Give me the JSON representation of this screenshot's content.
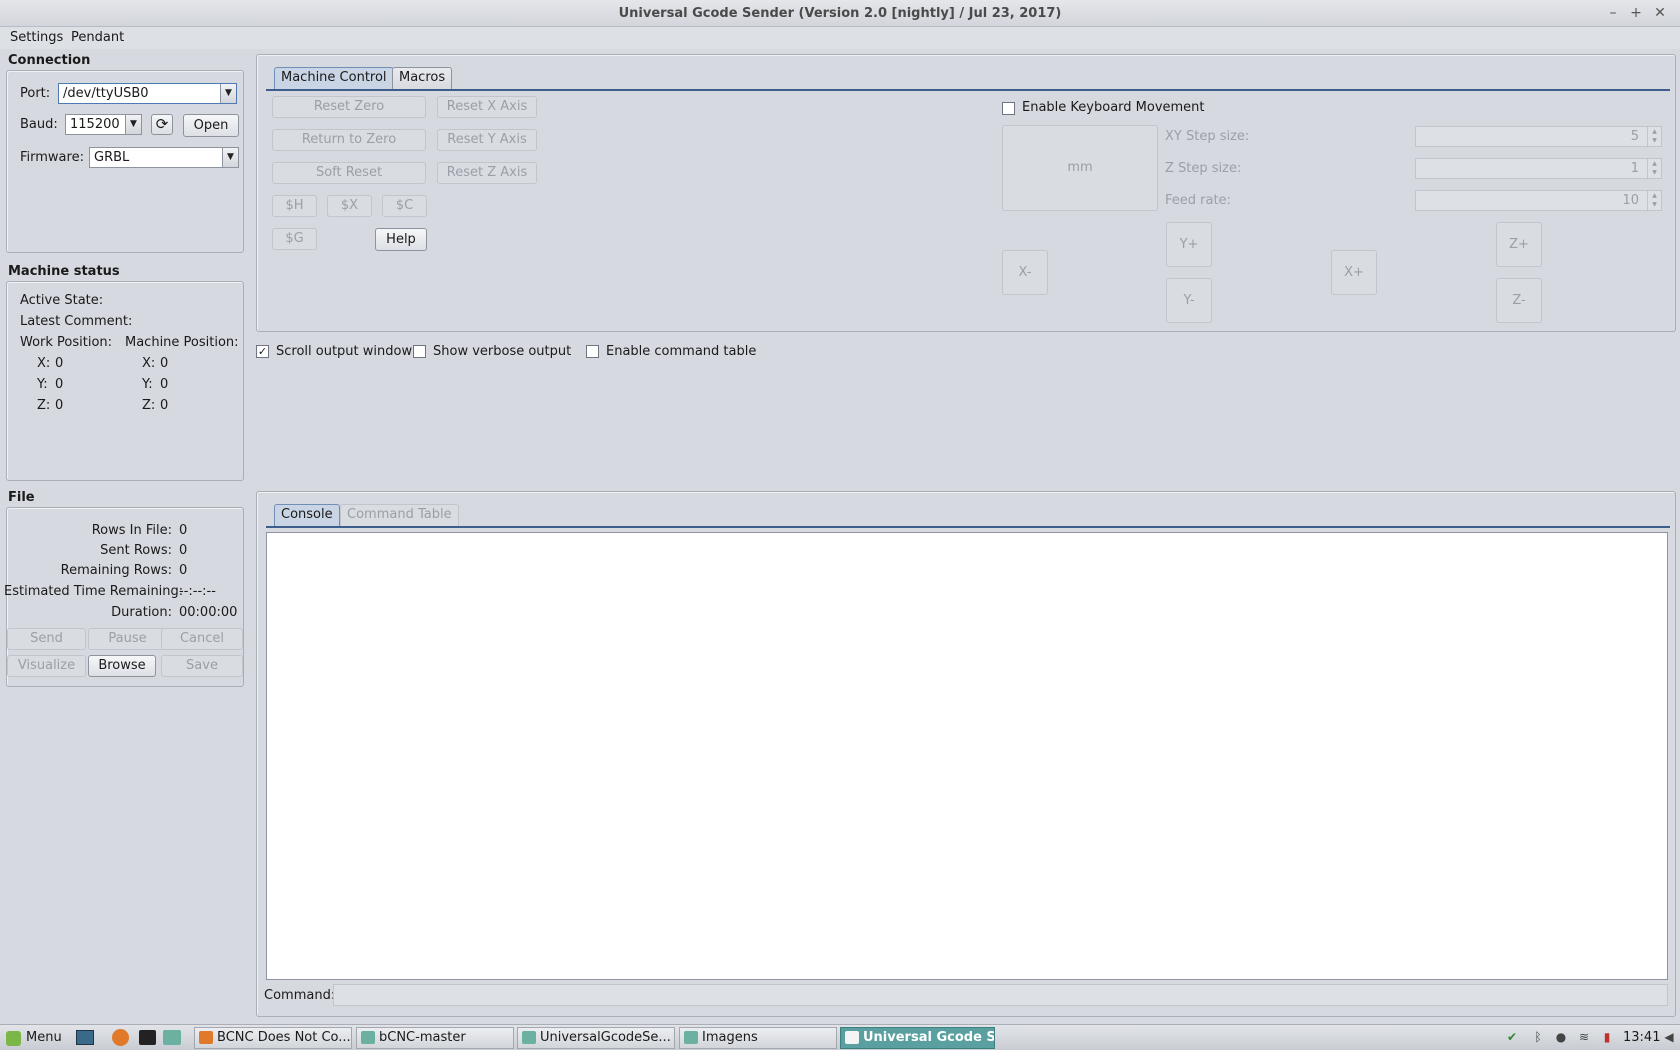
{
  "window": {
    "title": "Universal Gcode Sender (Version 2.0 [nightly]  / Jul 23, 2017)",
    "controls": {
      "minimize": "–",
      "maximize": "+",
      "close": "✕"
    }
  },
  "menubar": [
    "Settings",
    "Pendant"
  ],
  "connection": {
    "title": "Connection",
    "port_label": "Port:",
    "port_value": "/dev/ttyUSB0",
    "baud_label": "Baud:",
    "baud_value": "115200",
    "open_label": "Open",
    "firmware_label": "Firmware:",
    "firmware_value": "GRBL"
  },
  "machine_status": {
    "title": "Machine status",
    "active_state_label": "Active State:",
    "latest_comment_label": "Latest Comment:",
    "work_position_label": "Work Position:",
    "machine_position_label": "Machine Position:",
    "work": [
      {
        "axis": "X:",
        "value": "0"
      },
      {
        "axis": "Y:",
        "value": "0"
      },
      {
        "axis": "Z:",
        "value": "0"
      }
    ],
    "machine": [
      {
        "axis": "X:",
        "value": "0"
      },
      {
        "axis": "Y:",
        "value": "0"
      },
      {
        "axis": "Z:",
        "value": "0"
      }
    ]
  },
  "file": {
    "title": "File",
    "rows": [
      {
        "label": "Rows In File:",
        "value": "0"
      },
      {
        "label": "Sent Rows:",
        "value": "0"
      },
      {
        "label": "Remaining Rows:",
        "value": "0"
      },
      {
        "label": "Estimated Time Remaining:",
        "value": "--:--:--"
      },
      {
        "label": "Duration:",
        "value": "00:00:00"
      }
    ],
    "buttons": {
      "send": "Send",
      "pause": "Pause",
      "cancel": "Cancel",
      "visualize": "Visualize",
      "browse": "Browse",
      "save": "Save"
    }
  },
  "top_tabs": [
    "Machine Control",
    "Macros"
  ],
  "machine_control": {
    "reset_zero": "Reset Zero",
    "reset_x": "Reset X Axis",
    "return_to_zero": "Return to Zero",
    "reset_y": "Reset Y Axis",
    "soft_reset": "Soft Reset",
    "reset_z": "Reset Z Axis",
    "home": "$H",
    "kill_alarm": "$X",
    "check": "$C",
    "gcode_state": "$G",
    "help": "Help"
  },
  "jog": {
    "enable_keyboard_label": "Enable Keyboard Movement",
    "units_label": "mm",
    "xy_step_label": "XY Step size:",
    "xy_step_value": "5",
    "z_step_label": "Z Step size:",
    "z_step_value": "1",
    "feed_rate_label": "Feed rate:",
    "feed_rate_value": "10",
    "x_minus": "X-",
    "x_plus": "X+",
    "y_plus": "Y+",
    "y_minus": "Y-",
    "z_plus": "Z+",
    "z_minus": "Z-"
  },
  "options": {
    "scroll_output": "Scroll output window",
    "scroll_output_checked": true,
    "verbose_output": "Show verbose output",
    "verbose_output_checked": false,
    "command_table": "Enable command table",
    "command_table_checked": false
  },
  "bottom_tabs": [
    "Console",
    "Command Table"
  ],
  "console": {
    "command_label": "Command:",
    "command_value": ""
  },
  "taskbar": {
    "menu_label": "Menu",
    "items": [
      "BCNC Does Not Co...",
      "bCNC-master",
      "UniversalGcodeSe...",
      "Imagens",
      "Universal Gcode Se..."
    ],
    "clock": "13:41"
  }
}
